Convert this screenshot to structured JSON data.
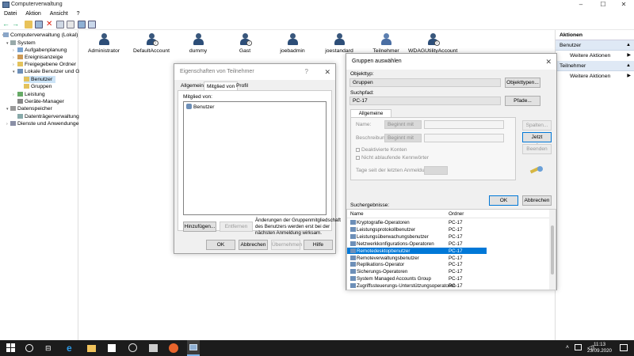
{
  "window": {
    "title": "Computerverwaltung"
  },
  "menu": [
    "Datei",
    "Aktion",
    "Ansicht",
    "?"
  ],
  "tree": {
    "items": [
      {
        "label": "Computerverwaltung (Lokal)",
        "level": 0
      },
      {
        "label": "System",
        "level": 1
      },
      {
        "label": "Aufgabenplanung",
        "level": 2
      },
      {
        "label": "Ereignisanzeige",
        "level": 2
      },
      {
        "label": "Freigegebene Ordner",
        "level": 2
      },
      {
        "label": "Lokale Benutzer und Gru",
        "level": 2
      },
      {
        "label": "Benutzer",
        "level": 3
      },
      {
        "label": "Gruppen",
        "level": 3
      },
      {
        "label": "Leistung",
        "level": 2
      },
      {
        "label": "Geräte-Manager",
        "level": 2
      },
      {
        "label": "Datenspeicher",
        "level": 1
      },
      {
        "label": "Datenträgerverwaltung",
        "level": 2
      },
      {
        "label": "Dienste und Anwendungen",
        "level": 1
      }
    ]
  },
  "users": [
    "Administrator",
    "DefaultAccount",
    "dummy",
    "Gast",
    "joebadmin",
    "joestandard",
    "Teilnehmer",
    "WDAGUtilityAccount"
  ],
  "actions": {
    "header": "Aktionen",
    "sections": [
      {
        "title": "Benutzer",
        "item": "Weitere Aktionen"
      },
      {
        "title": "Teilnehmer",
        "item": "Weitere Aktionen"
      }
    ]
  },
  "props_dialog": {
    "title": "Eigenschaften von Teilnehmer",
    "help": "?",
    "tabs": [
      "Allgemein",
      "Mitglied von",
      "Profil"
    ],
    "member_of_label": "Mitglied von:",
    "members": [
      "Benutzer"
    ],
    "add_button": "Hinzufügen...",
    "remove_button": "Entfernen",
    "note": [
      "Änderungen der Gruppenmitgliedschaft",
      "des Benutzers werden erst bei der",
      "nächsten Anmeldung wirksam."
    ],
    "ok": "OK",
    "cancel": "Abbrechen",
    "apply": "Übernehmen",
    "help_button": "Hilfe"
  },
  "select_dialog": {
    "title": "Gruppen auswählen",
    "object_type_label": "Objekttyp:",
    "object_type": "Gruppen",
    "object_types_button": "Objekttypen...",
    "search_path_label": "Suchpfad:",
    "search_path": "PC-17",
    "paths_button": "Pfade...",
    "tab": "Allgemeine Abfragen",
    "name_label": "Name:",
    "name_mode": "Beginnt mit",
    "desc_label": "Beschreibung:",
    "desc_mode": "Beginnt mit",
    "disabled_accounts": "Deaktivierte Konten",
    "non_expiring": "Nicht ablaufende Kennwörter",
    "days_label": "Tage seit der letzten Anmeldung:",
    "columns_button": "Spalten...",
    "search_button": "Jetzt suchen",
    "stop_button": "Beenden",
    "ok": "OK",
    "cancel": "Abbrechen",
    "results_label": "Suchergebnisse:",
    "col_name": "Name",
    "col_folder": "Ordner",
    "results": [
      {
        "name": "Kryptografie-Operatoren",
        "folder": "PC-17"
      },
      {
        "name": "Leistungsprotokollbenutzer",
        "folder": "PC-17"
      },
      {
        "name": "Leistungsüberwachungsbenutzer",
        "folder": "PC-17"
      },
      {
        "name": "Netzwerkkonfigurations-Operatoren",
        "folder": "PC-17"
      },
      {
        "name": "Remotedesktopbenutzer",
        "folder": "PC-17"
      },
      {
        "name": "Remoteverwaltungsbenutzer",
        "folder": "PC-17"
      },
      {
        "name": "Replikations-Operator",
        "folder": "PC-17"
      },
      {
        "name": "Sicherungs-Operatoren",
        "folder": "PC-17"
      },
      {
        "name": "System Managed Accounts Group",
        "folder": "PC-17"
      },
      {
        "name": "Zugriffssteuerungs-Unterstützungsoperatoren",
        "folder": "PC-17"
      }
    ],
    "selected_index": 4
  },
  "taskbar": {
    "time": "11:13",
    "date": "23.09.2020"
  },
  "colors": {
    "accent": "#0078d7",
    "taskbar": "#1c1c1c",
    "selection": "#cce4f7"
  }
}
